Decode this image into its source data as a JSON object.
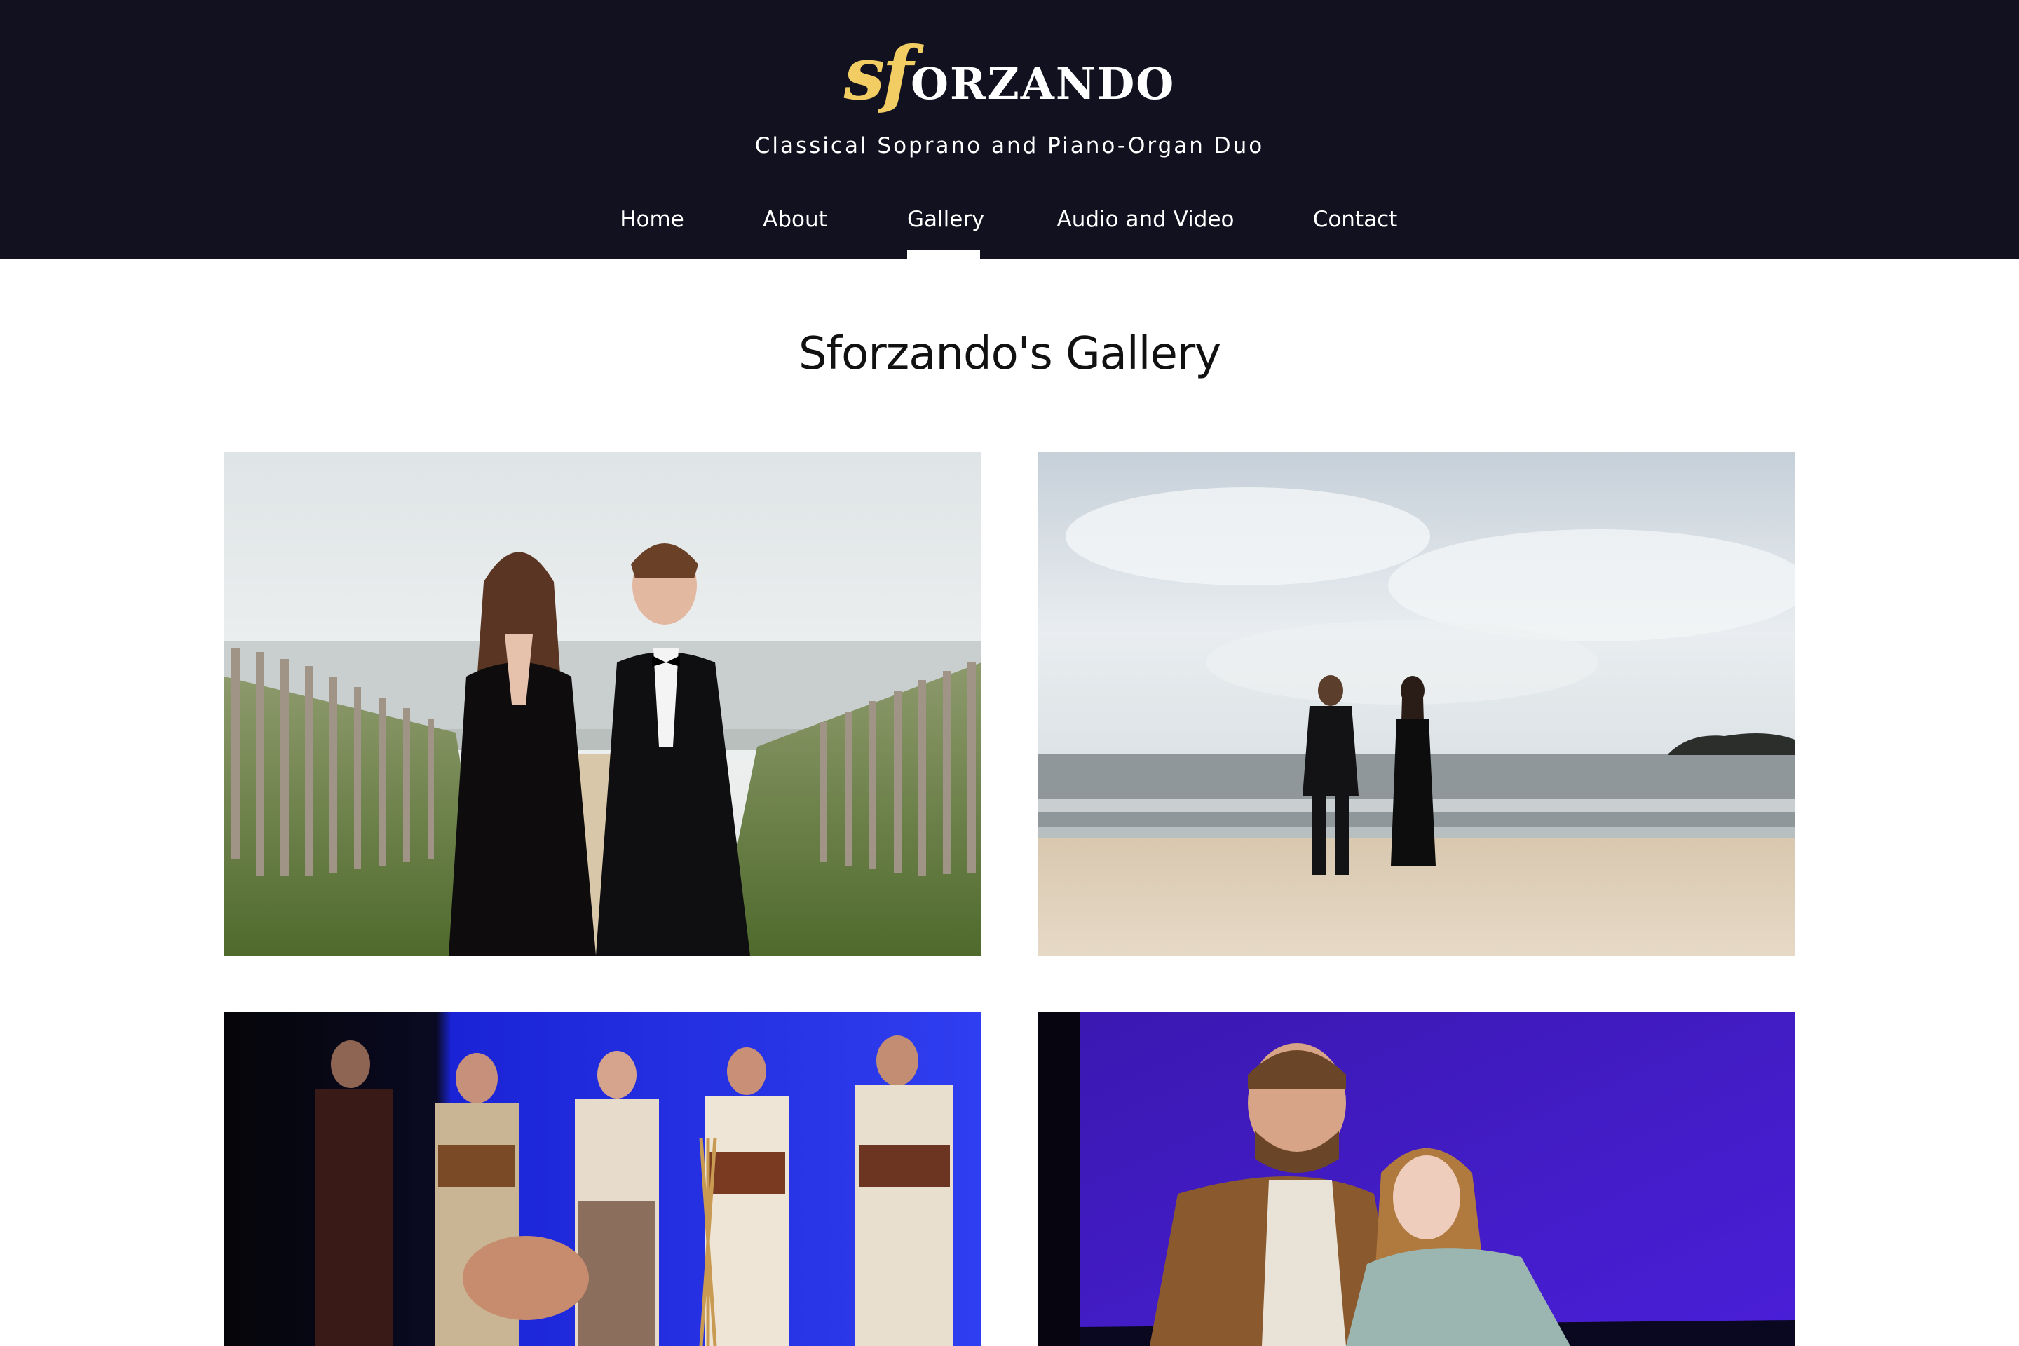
{
  "header": {
    "logo_sf": "sf",
    "logo_rest": "ORZANDO",
    "tagline": "Classical Soprano and Piano-Organ Duo",
    "logo_color": "#f1cd63",
    "background": "#12111f"
  },
  "nav": {
    "items": [
      {
        "label": "Home"
      },
      {
        "label": "About"
      },
      {
        "label": "Gallery",
        "active": true
      },
      {
        "label": "Audio and Video"
      },
      {
        "label": "Contact"
      }
    ]
  },
  "main": {
    "title": "Sforzando's Gallery"
  },
  "gallery": {
    "photos": [
      {
        "subject": "duo-portrait-dunes"
      },
      {
        "subject": "duo-beach-sea"
      },
      {
        "subject": "stage-chorus-blue"
      },
      {
        "subject": "stage-couple-purple"
      }
    ]
  }
}
